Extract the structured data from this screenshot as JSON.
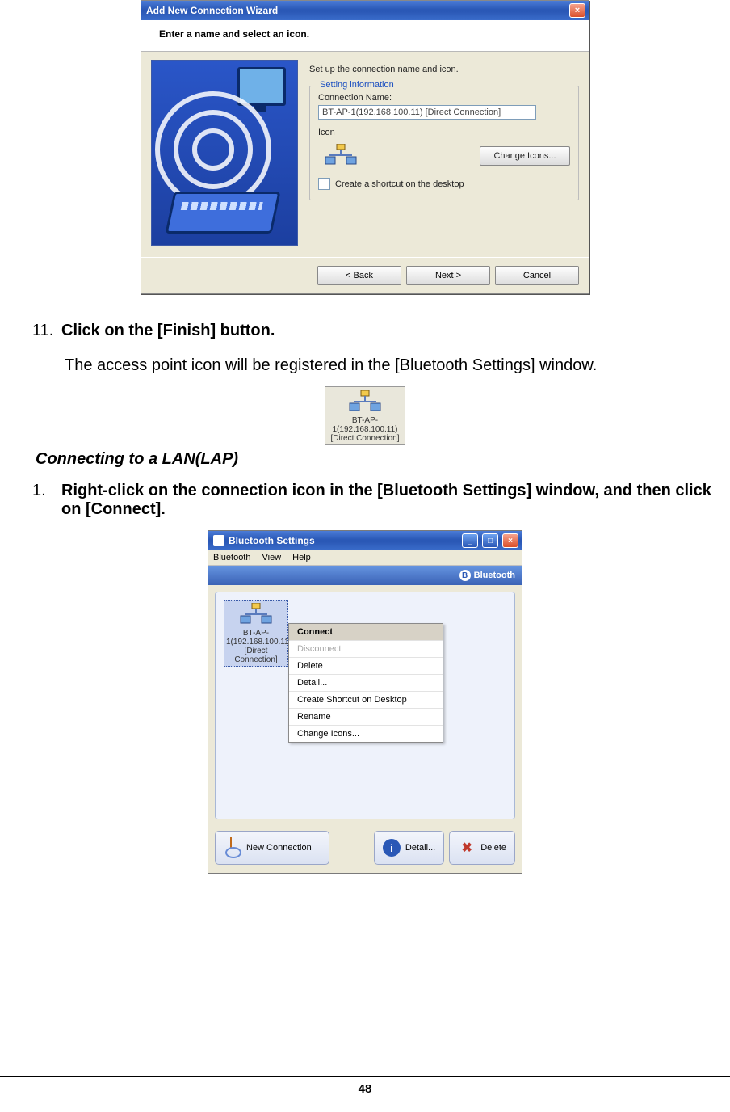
{
  "wizard": {
    "title": "Add New Connection Wizard",
    "header": "Enter a name and select an icon.",
    "instruction": "Set up the connection name and icon.",
    "fieldset_legend": "Setting information",
    "conn_name_label": "Connection Name:",
    "conn_name_value": "BT-AP-1(192.168.100.11) [Direct Connection]",
    "icon_label": "Icon",
    "change_icons_btn": "Change Icons...",
    "shortcut_checkbox": "Create a shortcut on the desktop",
    "back_btn": "< Back",
    "next_btn": "Next >",
    "cancel_btn": "Cancel"
  },
  "doc": {
    "step11_num": "11.",
    "step11_text": "Click on the [Finish] button.",
    "step11_body": "The access point icon will be registered in the [Bluetooth Settings] window.",
    "ap_icon_caption": "BT-AP-1(192.168.100.11) [Direct Connection]",
    "subtitle": "Connecting to a LAN(LAP)",
    "step1_num": "1.",
    "step1_text": "Right-click on the connection icon in the [Bluetooth Settings] window, and then click on [Connect].",
    "page_number": "48"
  },
  "bt": {
    "title": "Bluetooth Settings",
    "menu": {
      "bluetooth": "Bluetooth",
      "view": "View",
      "help": "Help"
    },
    "brand": "Bluetooth",
    "item_caption": "BT-AP-1(192.168.100.11) [Direct Connection]",
    "ctx": {
      "connect": "Connect",
      "disconnect": "Disconnect",
      "delete": "Delete",
      "detail": "Detail...",
      "shortcut": "Create Shortcut on Desktop",
      "rename": "Rename",
      "change_icons": "Change Icons..."
    },
    "buttons": {
      "new": "New Connection",
      "detail": "Detail...",
      "delete": "Delete"
    }
  }
}
